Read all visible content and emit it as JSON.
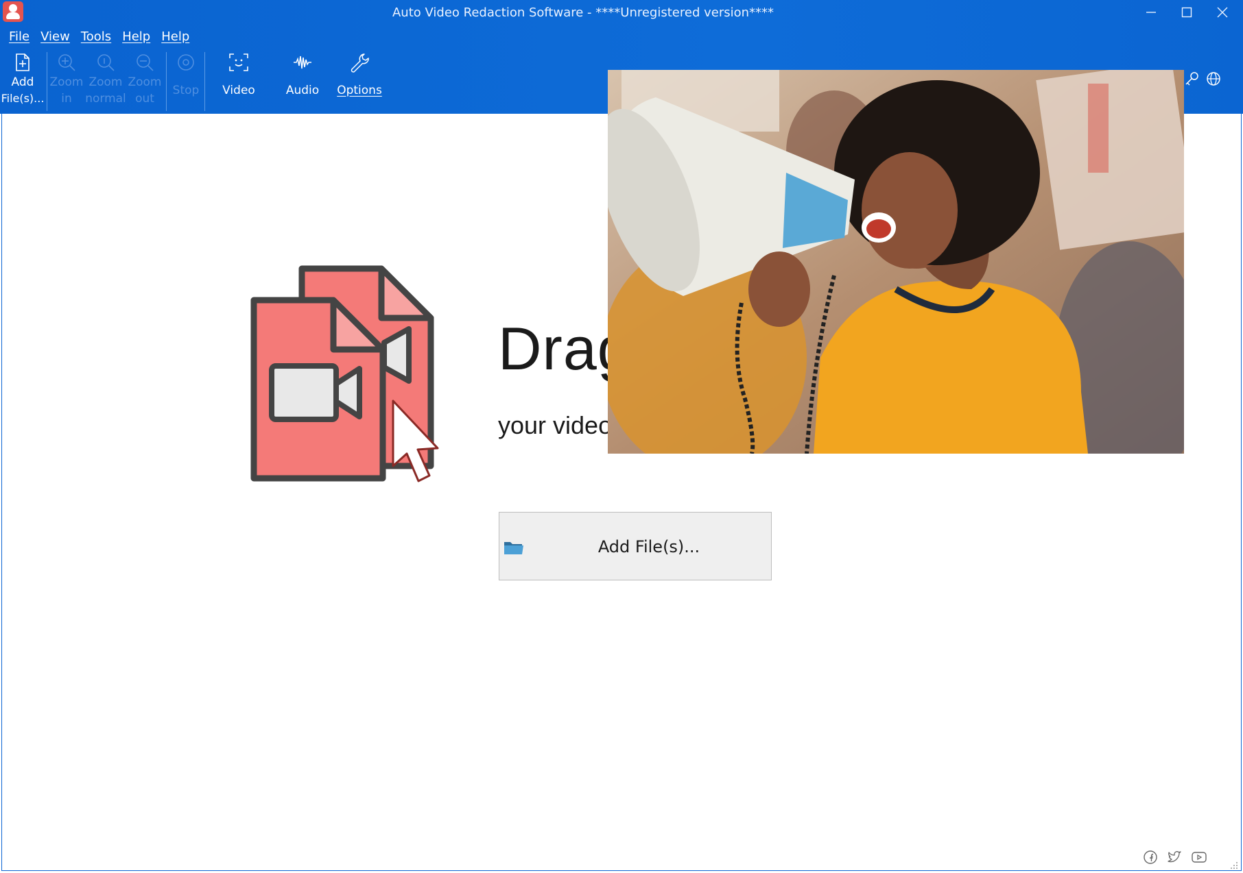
{
  "window": {
    "title": "Auto Video Redaction Software - ****Unregistered version****"
  },
  "menu": [
    "File",
    "View",
    "Tools",
    "Help",
    "Help"
  ],
  "toolbar": {
    "add_files": {
      "line1": "Add",
      "line2": "File(s)..."
    },
    "zoom_in": {
      "line1": "Zoom",
      "line2": "in"
    },
    "zoom_normal": {
      "line1": "Zoom",
      "line2": "normal"
    },
    "zoom_out": {
      "line1": "Zoom",
      "line2": "out"
    },
    "stop": "Stop",
    "video": "Video",
    "audio": "Audio",
    "options": "Options"
  },
  "drop": {
    "heading": "Drag",
    "sub": "your video",
    "add_button": "Add File(s)..."
  },
  "colors": {
    "titlebar": "#0b65d2",
    "file_icon": "#f47a78",
    "file_icon_outline": "#444444"
  },
  "social_icons": [
    "facebook-icon",
    "twitter-icon",
    "youtube-icon"
  ]
}
